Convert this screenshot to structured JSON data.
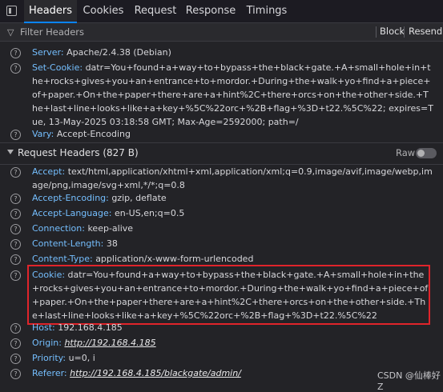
{
  "tabs": [
    "Headers",
    "Cookies",
    "Request",
    "Response",
    "Timings"
  ],
  "filter": {
    "placeholder": "Filter Headers",
    "block_label": "Block",
    "resend_label": "Resend"
  },
  "response_headers": [
    {
      "name": "Server:",
      "value": "Apache/2.4.38 (Debian)"
    },
    {
      "name": "Set-Cookie:",
      "value": "datr=You+found+a+way+to+bypass+the+black+gate.+A+small+hole+in+the+rocks+gives+you+an+entrance+to+mordor.+During+the+walk+yo+find+a+piece+of+paper.+On+the+paper+there+are+a+hint%2C+there+orcs+on+the+other+side.+The+last+line+looks+like+a+key+%5C%22orc+%2B+flag+%3D+t22.%5C%22; expires=Tue, 13-May-2025 03:18:58 GMT; Max-Age=2592000; path=/"
    },
    {
      "name": "Vary:",
      "value": "Accept-Encoding"
    }
  ],
  "request_section": {
    "title": "Request Headers (827 B)",
    "raw_label": "Raw"
  },
  "request_headers": [
    {
      "name": "Accept:",
      "value": "text/html,application/xhtml+xml,application/xml;q=0.9,image/avif,image/webp,image/png,image/svg+xml,*/*;q=0.8"
    },
    {
      "name": "Accept-Encoding:",
      "value": "gzip, deflate"
    },
    {
      "name": "Accept-Language:",
      "value": "en-US,en;q=0.5"
    },
    {
      "name": "Connection:",
      "value": "keep-alive"
    },
    {
      "name": "Content-Length:",
      "value": "38"
    },
    {
      "name": "Content-Type:",
      "value": "application/x-www-form-urlencoded"
    },
    {
      "name": "Cookie:",
      "value": "datr=You+found+a+way+to+bypass+the+black+gate.+A+small+hole+in+the+rocks+gives+you+an+entrance+to+mordor.+During+the+walk+yo+find+a+piece+of+paper.+On+the+paper+there+are+a+hint%2C+there+orcs+on+the+other+side.+The+last+line+looks+like+a+key+%5C%22orc+%2B+flag+%3D+t22.%5C%22"
    },
    {
      "name": "Host:",
      "value": "192.168.4.185"
    },
    {
      "name": "Origin:",
      "value": "http://192.168.4.185"
    },
    {
      "name": "Priority:",
      "value": "u=0, i"
    },
    {
      "name": "Referer:",
      "value": "http://192.168.4.185/blackgate/admin/"
    }
  ],
  "watermark": "CSDN @仙棒好Z",
  "colors": {
    "accent": "#0a84ff",
    "header_name": "#75bfff",
    "highlight_box": "#e0242b"
  }
}
